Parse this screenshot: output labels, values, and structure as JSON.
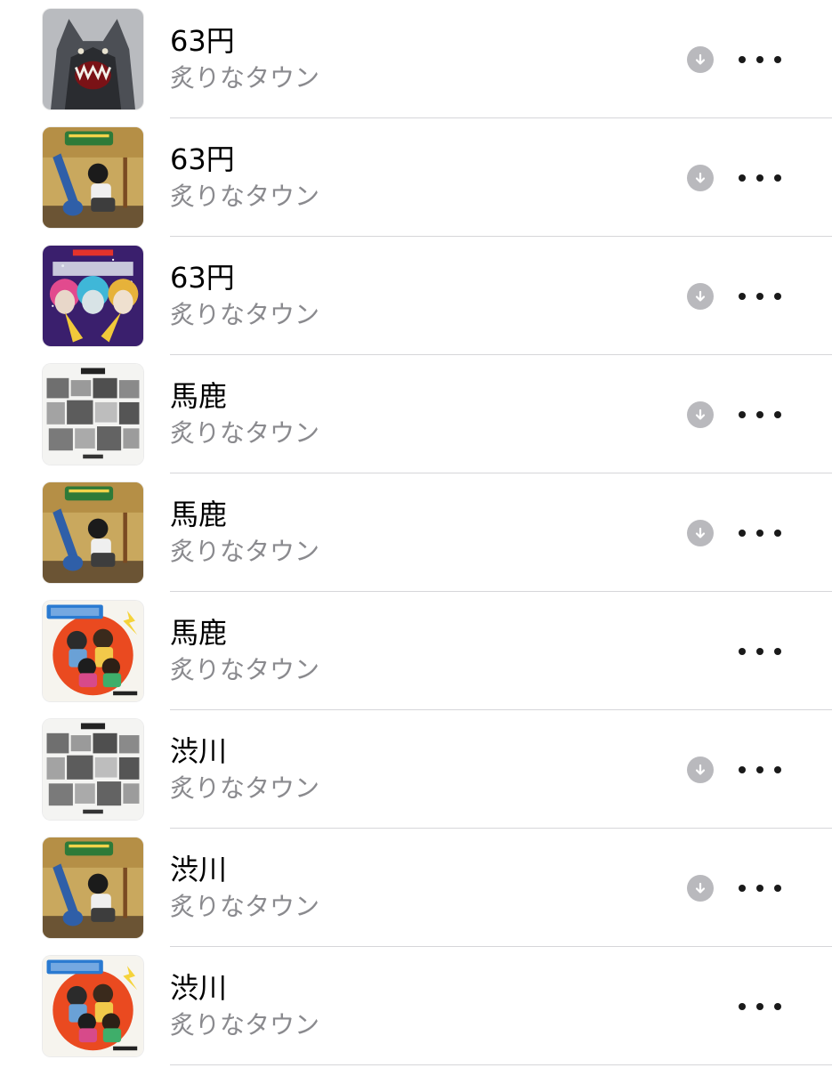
{
  "songs": [
    {
      "title": "63円",
      "artist": "炙りなタウン",
      "art": "wolf",
      "downloadable": true,
      "art_text": "狼煙"
    },
    {
      "title": "63円",
      "artist": "炙りなタウン",
      "art": "guitar",
      "downloadable": true,
      "art_text": "炙りなタウン"
    },
    {
      "title": "63円",
      "artist": "炙りなタウン",
      "art": "galaxy",
      "downloadable": true,
      "art_text": "曲者達"
    },
    {
      "title": "馬鹿",
      "artist": "炙りなタウン",
      "art": "photos",
      "downloadable": true,
      "art_text": "我楽多"
    },
    {
      "title": "馬鹿",
      "artist": "炙りなタウン",
      "art": "guitar",
      "downloadable": true,
      "art_text": "炙りなタウン"
    },
    {
      "title": "馬鹿",
      "artist": "炙りなタウン",
      "art": "wakamono",
      "downloadable": false,
      "art_text": "若者達"
    },
    {
      "title": "渋川",
      "artist": "炙りなタウン",
      "art": "photos",
      "downloadable": true,
      "art_text": "我楽多"
    },
    {
      "title": "渋川",
      "artist": "炙りなタウン",
      "art": "guitar",
      "downloadable": true,
      "art_text": "炙りなタウン"
    },
    {
      "title": "渋川",
      "artist": "炙りなタウン",
      "art": "wakamono",
      "downloadable": false,
      "art_text": "若者達"
    }
  ],
  "icons": {
    "download": "arrow-down-circle-icon",
    "more": "ellipsis-icon"
  },
  "colors": {
    "title": "#000000",
    "artist": "#8a8a8e",
    "download_badge": "#b9b9bd",
    "separator": "#d6d6d9"
  }
}
